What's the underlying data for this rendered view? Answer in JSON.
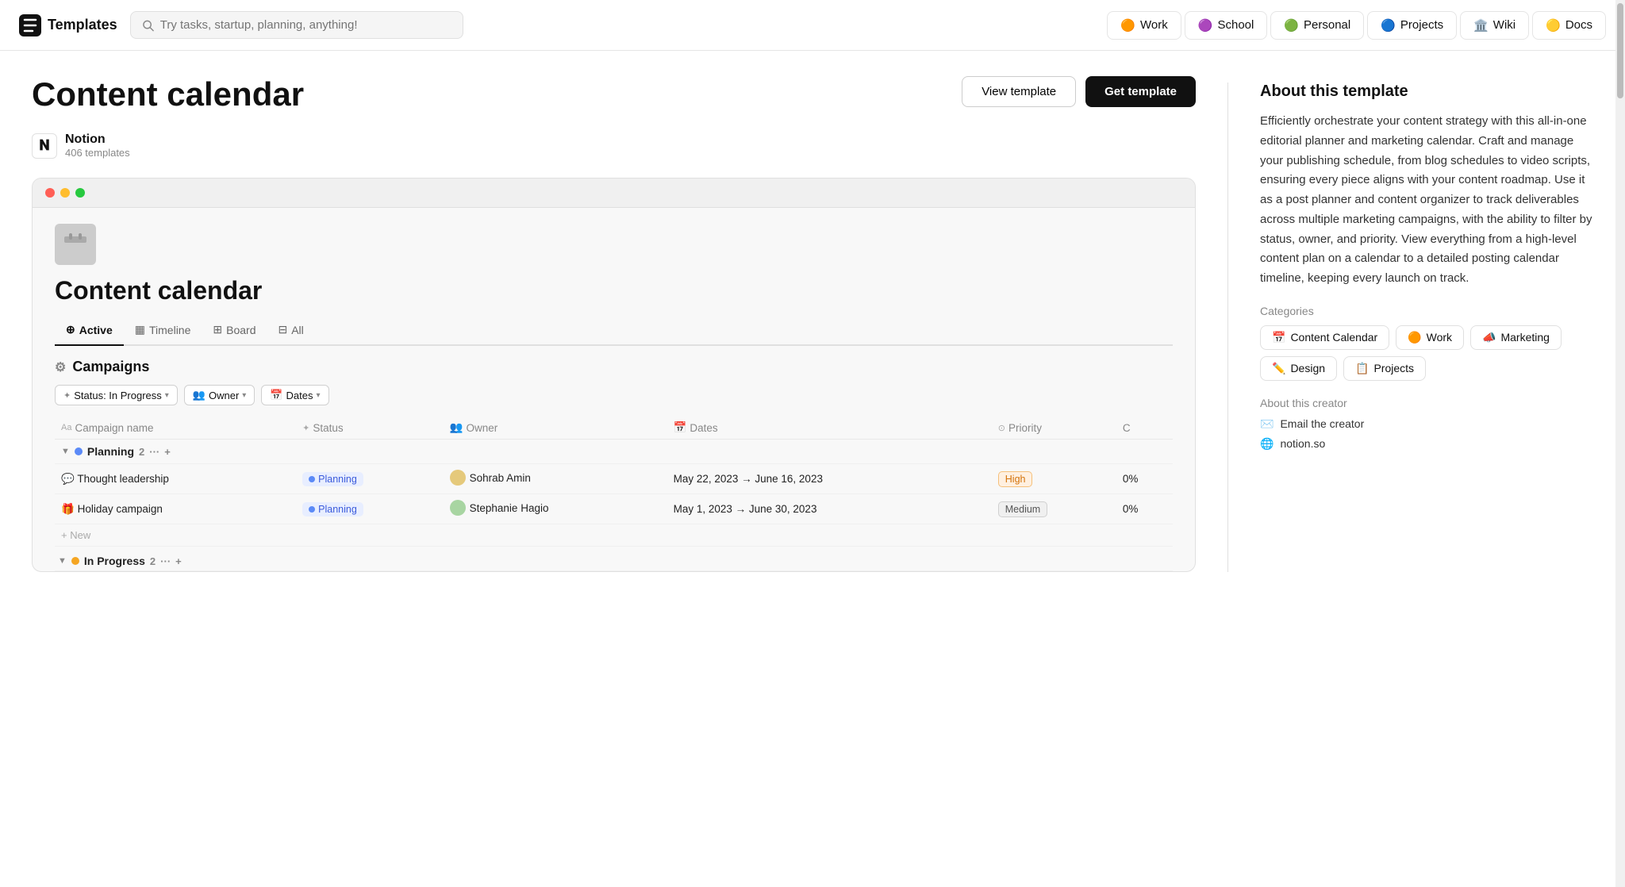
{
  "header": {
    "logo_label": "Templates",
    "search_placeholder": "Try tasks, startup, planning, anything!",
    "nav_items": [
      {
        "id": "work",
        "label": "Work",
        "icon": "🟠"
      },
      {
        "id": "school",
        "label": "School",
        "icon": "🟣"
      },
      {
        "id": "personal",
        "label": "Personal",
        "icon": "🟢"
      },
      {
        "id": "projects",
        "label": "Projects",
        "icon": "🔵"
      },
      {
        "id": "wiki",
        "label": "Wiki",
        "icon": "🏛️"
      },
      {
        "id": "docs",
        "label": "Docs",
        "icon": "🟡"
      }
    ]
  },
  "page": {
    "title": "Content calendar",
    "creator": {
      "name": "Notion",
      "sub_label": "406 templates"
    },
    "view_template_label": "View template",
    "get_template_label": "Get template"
  },
  "preview": {
    "title": "Content calendar",
    "tabs": [
      {
        "id": "active",
        "label": "Active",
        "icon": "⊕"
      },
      {
        "id": "timeline",
        "label": "Timeline",
        "icon": "▦"
      },
      {
        "id": "board",
        "label": "Board",
        "icon": "⊞"
      },
      {
        "id": "all",
        "label": "All",
        "icon": "⊟"
      }
    ],
    "section_title": "Campaigns",
    "filters": [
      {
        "id": "status",
        "label": "Status: In Progress",
        "icon": "✦"
      },
      {
        "id": "owner",
        "label": "Owner",
        "icon": "👥"
      },
      {
        "id": "dates",
        "label": "Dates",
        "icon": "📅"
      }
    ],
    "table_headers": [
      "Campaign name",
      "Status",
      "Owner",
      "Dates",
      "Priority",
      "C"
    ],
    "groups": [
      {
        "id": "planning",
        "label": "Planning",
        "count": 2,
        "color": "planning",
        "rows": [
          {
            "name": "Thought leadership",
            "icon": "💬",
            "status": "Planning",
            "status_class": "badge-planning",
            "owner": "Sohrab Amin",
            "dates": "May 22, 2023 → June 16, 2023",
            "priority": "High",
            "priority_class": "priority-high",
            "completion": "0%"
          },
          {
            "name": "Holiday campaign",
            "icon": "🎁",
            "status": "Planning",
            "status_class": "badge-planning",
            "owner": "Stephanie Hagio",
            "dates": "May 1, 2023 → June 30, 2023",
            "priority": "Medium",
            "priority_class": "priority-medium",
            "completion": "0%"
          }
        ]
      },
      {
        "id": "in-progress",
        "label": "In Progress",
        "count": 2,
        "color": "inprogress"
      }
    ]
  },
  "sidebar": {
    "about_title": "About this template",
    "description": "Efficiently orchestrate your content strategy with this all-in-one editorial planner and marketing calendar. Craft and manage your publishing schedule, from blog schedules to video scripts, ensuring every piece aligns with your content roadmap. Use it as a post planner and content organizer to track deliverables across multiple marketing campaigns, with the ability to filter by status, owner, and priority. View everything from a high-level content plan on a calendar to a detailed posting calendar timeline, keeping every launch on track.",
    "categories_title": "Categories",
    "categories": [
      {
        "id": "content-calendar",
        "label": "Content Calendar",
        "icon": "📅"
      },
      {
        "id": "work",
        "label": "Work",
        "icon": "🟠"
      },
      {
        "id": "marketing",
        "label": "Marketing",
        "icon": "📣"
      },
      {
        "id": "design",
        "label": "Design",
        "icon": "✏️"
      },
      {
        "id": "projects",
        "label": "Projects",
        "icon": "📋"
      }
    ],
    "about_creator_title": "About this creator",
    "creator_links": [
      {
        "id": "email",
        "label": "Email the creator",
        "icon": "✉️"
      },
      {
        "id": "website",
        "label": "notion.so",
        "icon": "🌐"
      }
    ]
  }
}
